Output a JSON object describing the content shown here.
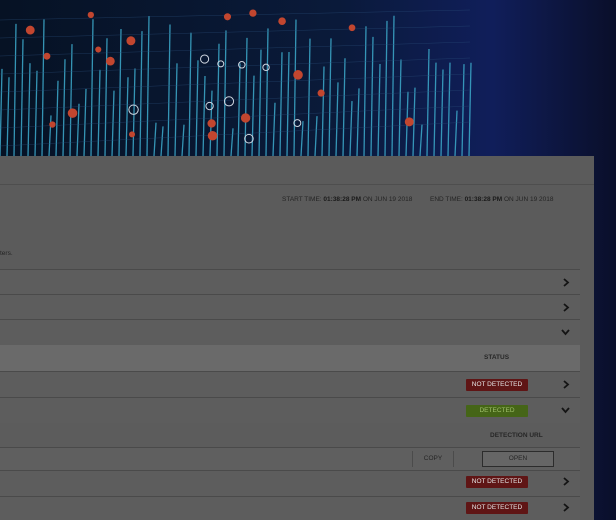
{
  "header": {
    "start_label": "START TIME:",
    "start_time": "01:38:28 PM",
    "start_on": "ON JUN 19 2018",
    "end_label": "END TIME:",
    "end_time": "01:38:28 PM",
    "end_on": "ON JUN 19 2018"
  },
  "description_fragment": "ters.",
  "table": {
    "status_header": "STATUS",
    "detection_url_header": "DETECTION URL",
    "rows": [
      {
        "status": "NOT DETECTED"
      },
      {
        "status": "DETECTED"
      },
      {
        "status": "NOT DETECTED"
      },
      {
        "status": "NOT DETECTED"
      }
    ],
    "copy_label": "COPY",
    "open_label": "OPEN"
  },
  "icons": {
    "collapse": "chevron-down-icon",
    "expand": "chevron-right-icon"
  },
  "colors": {
    "not_detected": "#5f1515",
    "detected": "#456517",
    "background": "#0a0f24"
  }
}
